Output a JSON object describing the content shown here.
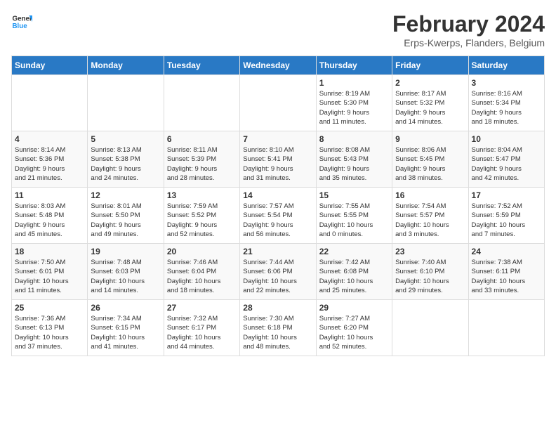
{
  "header": {
    "logo_general": "General",
    "logo_blue": "Blue",
    "month_title": "February 2024",
    "location": "Erps-Kwerps, Flanders, Belgium"
  },
  "weekdays": [
    "Sunday",
    "Monday",
    "Tuesday",
    "Wednesday",
    "Thursday",
    "Friday",
    "Saturday"
  ],
  "weeks": [
    [
      {
        "day": "",
        "info": ""
      },
      {
        "day": "",
        "info": ""
      },
      {
        "day": "",
        "info": ""
      },
      {
        "day": "",
        "info": ""
      },
      {
        "day": "1",
        "info": "Sunrise: 8:19 AM\nSunset: 5:30 PM\nDaylight: 9 hours\nand 11 minutes."
      },
      {
        "day": "2",
        "info": "Sunrise: 8:17 AM\nSunset: 5:32 PM\nDaylight: 9 hours\nand 14 minutes."
      },
      {
        "day": "3",
        "info": "Sunrise: 8:16 AM\nSunset: 5:34 PM\nDaylight: 9 hours\nand 18 minutes."
      }
    ],
    [
      {
        "day": "4",
        "info": "Sunrise: 8:14 AM\nSunset: 5:36 PM\nDaylight: 9 hours\nand 21 minutes."
      },
      {
        "day": "5",
        "info": "Sunrise: 8:13 AM\nSunset: 5:38 PM\nDaylight: 9 hours\nand 24 minutes."
      },
      {
        "day": "6",
        "info": "Sunrise: 8:11 AM\nSunset: 5:39 PM\nDaylight: 9 hours\nand 28 minutes."
      },
      {
        "day": "7",
        "info": "Sunrise: 8:10 AM\nSunset: 5:41 PM\nDaylight: 9 hours\nand 31 minutes."
      },
      {
        "day": "8",
        "info": "Sunrise: 8:08 AM\nSunset: 5:43 PM\nDaylight: 9 hours\nand 35 minutes."
      },
      {
        "day": "9",
        "info": "Sunrise: 8:06 AM\nSunset: 5:45 PM\nDaylight: 9 hours\nand 38 minutes."
      },
      {
        "day": "10",
        "info": "Sunrise: 8:04 AM\nSunset: 5:47 PM\nDaylight: 9 hours\nand 42 minutes."
      }
    ],
    [
      {
        "day": "11",
        "info": "Sunrise: 8:03 AM\nSunset: 5:48 PM\nDaylight: 9 hours\nand 45 minutes."
      },
      {
        "day": "12",
        "info": "Sunrise: 8:01 AM\nSunset: 5:50 PM\nDaylight: 9 hours\nand 49 minutes."
      },
      {
        "day": "13",
        "info": "Sunrise: 7:59 AM\nSunset: 5:52 PM\nDaylight: 9 hours\nand 52 minutes."
      },
      {
        "day": "14",
        "info": "Sunrise: 7:57 AM\nSunset: 5:54 PM\nDaylight: 9 hours\nand 56 minutes."
      },
      {
        "day": "15",
        "info": "Sunrise: 7:55 AM\nSunset: 5:55 PM\nDaylight: 10 hours\nand 0 minutes."
      },
      {
        "day": "16",
        "info": "Sunrise: 7:54 AM\nSunset: 5:57 PM\nDaylight: 10 hours\nand 3 minutes."
      },
      {
        "day": "17",
        "info": "Sunrise: 7:52 AM\nSunset: 5:59 PM\nDaylight: 10 hours\nand 7 minutes."
      }
    ],
    [
      {
        "day": "18",
        "info": "Sunrise: 7:50 AM\nSunset: 6:01 PM\nDaylight: 10 hours\nand 11 minutes."
      },
      {
        "day": "19",
        "info": "Sunrise: 7:48 AM\nSunset: 6:03 PM\nDaylight: 10 hours\nand 14 minutes."
      },
      {
        "day": "20",
        "info": "Sunrise: 7:46 AM\nSunset: 6:04 PM\nDaylight: 10 hours\nand 18 minutes."
      },
      {
        "day": "21",
        "info": "Sunrise: 7:44 AM\nSunset: 6:06 PM\nDaylight: 10 hours\nand 22 minutes."
      },
      {
        "day": "22",
        "info": "Sunrise: 7:42 AM\nSunset: 6:08 PM\nDaylight: 10 hours\nand 25 minutes."
      },
      {
        "day": "23",
        "info": "Sunrise: 7:40 AM\nSunset: 6:10 PM\nDaylight: 10 hours\nand 29 minutes."
      },
      {
        "day": "24",
        "info": "Sunrise: 7:38 AM\nSunset: 6:11 PM\nDaylight: 10 hours\nand 33 minutes."
      }
    ],
    [
      {
        "day": "25",
        "info": "Sunrise: 7:36 AM\nSunset: 6:13 PM\nDaylight: 10 hours\nand 37 minutes."
      },
      {
        "day": "26",
        "info": "Sunrise: 7:34 AM\nSunset: 6:15 PM\nDaylight: 10 hours\nand 41 minutes."
      },
      {
        "day": "27",
        "info": "Sunrise: 7:32 AM\nSunset: 6:17 PM\nDaylight: 10 hours\nand 44 minutes."
      },
      {
        "day": "28",
        "info": "Sunrise: 7:30 AM\nSunset: 6:18 PM\nDaylight: 10 hours\nand 48 minutes."
      },
      {
        "day": "29",
        "info": "Sunrise: 7:27 AM\nSunset: 6:20 PM\nDaylight: 10 hours\nand 52 minutes."
      },
      {
        "day": "",
        "info": ""
      },
      {
        "day": "",
        "info": ""
      }
    ]
  ]
}
